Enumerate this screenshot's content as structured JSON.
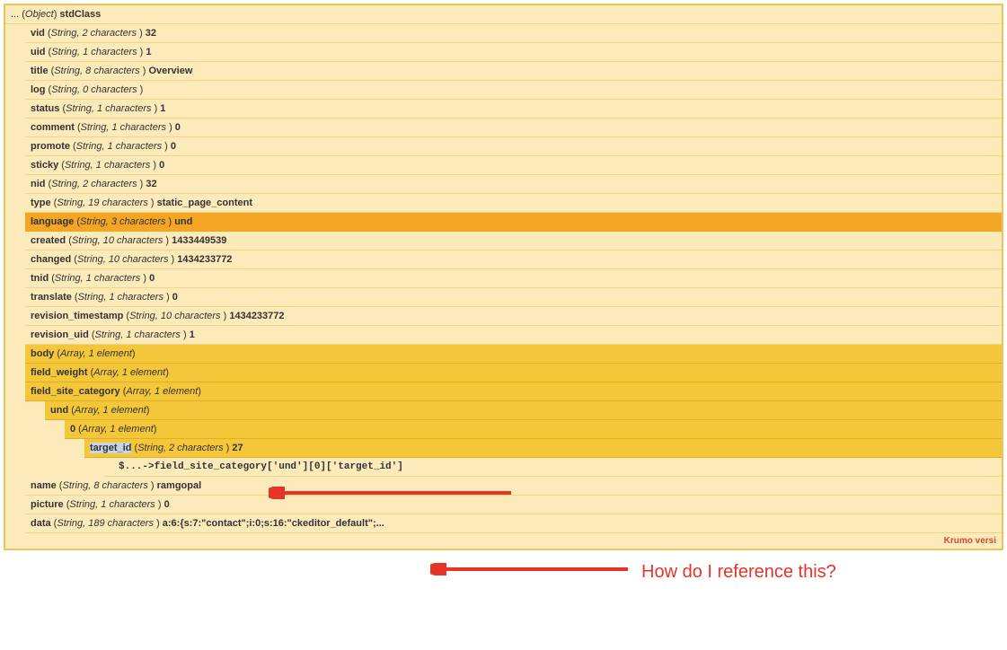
{
  "root": {
    "prefix": "... (",
    "type": "Object",
    "suffix": ") ",
    "class": "stdClass"
  },
  "rows": [
    {
      "key": "vid",
      "type": "String, 2 characters",
      "val": "32"
    },
    {
      "key": "uid",
      "type": "String, 1 characters",
      "val": "1"
    },
    {
      "key": "title",
      "type": "String, 8 characters",
      "val": "Overview"
    },
    {
      "key": "log",
      "type": "String, 0 characters",
      "val": ""
    },
    {
      "key": "status",
      "type": "String, 1 characters",
      "val": "1"
    },
    {
      "key": "comment",
      "type": "String, 1 characters",
      "val": "0"
    },
    {
      "key": "promote",
      "type": "String, 1 characters",
      "val": "0"
    },
    {
      "key": "sticky",
      "type": "String, 1 characters",
      "val": "0"
    },
    {
      "key": "nid",
      "type": "String, 2 characters",
      "val": "32"
    },
    {
      "key": "type",
      "type": "String, 19 characters",
      "val": "static_page_content"
    },
    {
      "key": "language",
      "type": "String, 3 characters",
      "val": "und",
      "highlight": true
    },
    {
      "key": "created",
      "type": "String, 10 characters",
      "val": "1433449539"
    },
    {
      "key": "changed",
      "type": "String, 10 characters",
      "val": "1434233772"
    },
    {
      "key": "tnid",
      "type": "String, 1 characters",
      "val": "0"
    },
    {
      "key": "translate",
      "type": "String, 1 characters",
      "val": "0"
    },
    {
      "key": "revision_timestamp",
      "type": "String, 10 characters",
      "val": "1434233772"
    },
    {
      "key": "revision_uid",
      "type": "String, 1 characters",
      "val": "1"
    },
    {
      "key": "body",
      "type": "Array, 1 element",
      "expandable": true
    },
    {
      "key": "field_weight",
      "type": "Array, 1 element",
      "expandable": true
    }
  ],
  "expanded": {
    "key": "field_site_category",
    "type": "Array, 1 element",
    "und": {
      "key": "und",
      "type": "Array, 1 element"
    },
    "zero": {
      "key": "0",
      "type": "Array, 1 element"
    },
    "target": {
      "key": "target_id",
      "type": "String, 2 characters",
      "val": "27"
    },
    "path": "$...->field_site_category['und'][0]['target_id']"
  },
  "after": [
    {
      "key": "name",
      "type": "String, 8 characters",
      "val": "ramgopal"
    },
    {
      "key": "picture",
      "type": "String, 1 characters",
      "val": "0"
    },
    {
      "key": "data",
      "type": "String, 189 characters",
      "val": "a:6:{s:7:\"contact\";i:0;s:16:\"ckeditor_default\";..."
    }
  ],
  "footer": "Krumo versi",
  "annotation": "How do I reference this?"
}
